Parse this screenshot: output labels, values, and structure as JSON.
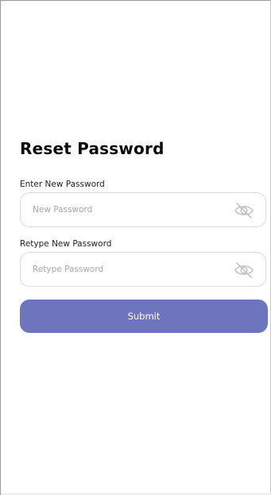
{
  "screen": {
    "title": "Reset Password"
  },
  "fields": [
    {
      "label": "Enter New Password",
      "placeholder": "New Password",
      "value": "",
      "toggle_icon": "eye-off-icon"
    },
    {
      "label": "Retype New Password",
      "placeholder": "Retype Password",
      "value": "",
      "toggle_icon": "eye-off-icon"
    }
  ],
  "actions": {
    "submit_label": "Submit"
  },
  "colors": {
    "primary": "#6e75bd",
    "border": "#dcdcdc",
    "placeholder": "#a8a8a8",
    "icon": "#c4c4c4",
    "text": "#0b0b0b"
  }
}
